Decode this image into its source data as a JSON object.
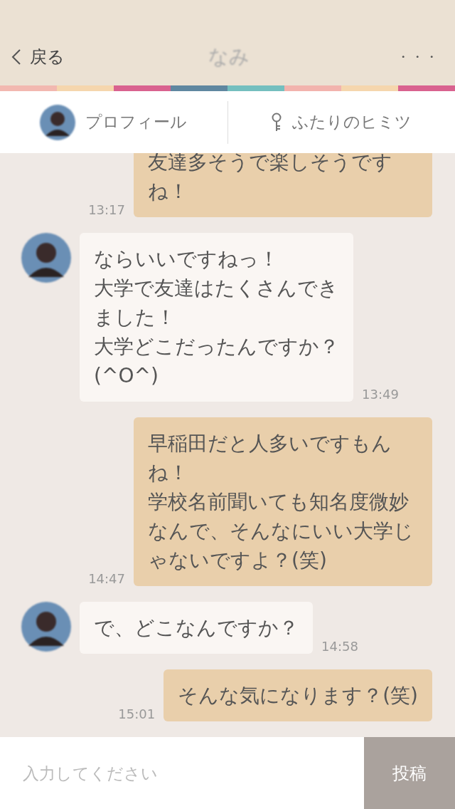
{
  "header": {
    "back_label": "戻る",
    "title": "なみ",
    "more": "・・・"
  },
  "stripe": [
    {
      "color": "#f2b8b0"
    },
    {
      "color": "#f5d6ad"
    },
    {
      "color": "#d9628f"
    },
    {
      "color": "#5f87a0"
    },
    {
      "color": "#74bfbf"
    },
    {
      "color": "#f2b3ad"
    },
    {
      "color": "#f5d6ad"
    },
    {
      "color": "#d9628f"
    }
  ],
  "tabs": [
    {
      "kind": "profile",
      "label": "プロフィール"
    },
    {
      "kind": "secret",
      "label": "ふたりのヒミツ"
    }
  ],
  "messages": [
    {
      "kind": "sent",
      "paragraphs": [
        "友達多そうで楽しそうですね！"
      ],
      "time": "13:17"
    },
    {
      "kind": "received",
      "paragraphs": [
        "ならいいですねっ！",
        "大学で友達はたくさんできました！",
        "大学どこだったんですか？(^O^)"
      ],
      "time": "13:49"
    },
    {
      "kind": "sent",
      "paragraphs": [
        "早稲田だと人多いですもんね！",
        "学校名前聞いても知名度微妙なんで、そんなにいい大学じゃないですよ？(笑)"
      ],
      "time": "14:47"
    },
    {
      "kind": "received",
      "paragraphs": [
        "で、どこなんですか？"
      ],
      "time": "14:58"
    },
    {
      "kind": "sent",
      "paragraphs": [
        "そんな気になります？(笑)"
      ],
      "time": "15:01"
    }
  ],
  "composer": {
    "placeholder": "入力してください",
    "send": "投稿"
  }
}
